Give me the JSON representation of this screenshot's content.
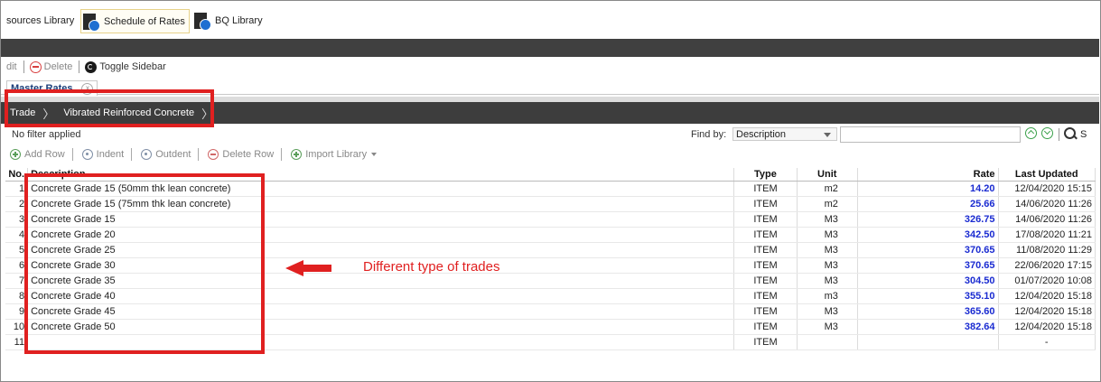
{
  "tabs": [
    {
      "label": "sources Library",
      "icon": "library-icon"
    },
    {
      "label": "Schedule of Rates",
      "icon": "rates-book-icon",
      "active": true
    },
    {
      "label": "BQ Library",
      "icon": "bq-book-icon"
    }
  ],
  "toolbar": {
    "edit_label": "dit",
    "delete_label": "Delete",
    "toggle_sidebar_label": "Toggle Sidebar"
  },
  "subtab": {
    "label": "Master Rates",
    "close": "x"
  },
  "breadcrumb": {
    "items": [
      "Trade",
      "Vibrated Reinforced Concrete"
    ]
  },
  "filter": {
    "status": "No filter applied",
    "find_by_label": "Find by:",
    "find_by_value": "Description",
    "search_label": "S",
    "search_value": ""
  },
  "row_tools": {
    "add_row": "Add Row",
    "indent": "Indent",
    "outdent": "Outdent",
    "delete_row": "Delete Row",
    "import_library": "Import Library"
  },
  "table": {
    "headers": {
      "no": "No.",
      "description": "Description",
      "type": "Type",
      "unit": "Unit",
      "rate": "Rate",
      "last_updated": "Last Updated"
    },
    "rows": [
      {
        "no": "1",
        "description": "Concrete Grade 15 (50mm thk lean concrete)",
        "type": "ITEM",
        "unit": "m2",
        "rate": "14.20",
        "last_updated": "12/04/2020 15:15"
      },
      {
        "no": "2",
        "description": "Concrete Grade 15 (75mm thk lean concrete)",
        "type": "ITEM",
        "unit": "m2",
        "rate": "25.66",
        "last_updated": "14/06/2020 11:26"
      },
      {
        "no": "3",
        "description": "Concrete Grade 15",
        "type": "ITEM",
        "unit": "M3",
        "rate": "326.75",
        "last_updated": "14/06/2020 11:26"
      },
      {
        "no": "4",
        "description": "Concrete Grade 20",
        "type": "ITEM",
        "unit": "M3",
        "rate": "342.50",
        "last_updated": "17/08/2020 11:21"
      },
      {
        "no": "5",
        "description": "Concrete Grade 25",
        "type": "ITEM",
        "unit": "M3",
        "rate": "370.65",
        "last_updated": "11/08/2020 11:29"
      },
      {
        "no": "6",
        "description": "Concrete Grade 30",
        "type": "ITEM",
        "unit": "M3",
        "rate": "370.65",
        "last_updated": "22/06/2020 17:15"
      },
      {
        "no": "7",
        "description": "Concrete Grade 35",
        "type": "ITEM",
        "unit": "M3",
        "rate": "304.50",
        "last_updated": "01/07/2020 10:08"
      },
      {
        "no": "8",
        "description": "Concrete Grade 40",
        "type": "ITEM",
        "unit": "m3",
        "rate": "355.10",
        "last_updated": "12/04/2020 15:18"
      },
      {
        "no": "9",
        "description": "Concrete Grade 45",
        "type": "ITEM",
        "unit": "M3",
        "rate": "365.60",
        "last_updated": "12/04/2020 15:18"
      },
      {
        "no": "10",
        "description": "Concrete Grade 50",
        "type": "ITEM",
        "unit": "M3",
        "rate": "382.64",
        "last_updated": "12/04/2020 15:18"
      },
      {
        "no": "11",
        "description": "",
        "type": "ITEM",
        "unit": "",
        "rate": "",
        "last_updated": "-"
      }
    ]
  },
  "annotation": {
    "text": "Different type of trades",
    "color": "#e02020"
  },
  "colors": {
    "rate_value": "#1a2bd1",
    "header_bar": "#404040",
    "breadcrumb_bar": "#3d3d3d",
    "subtab_text": "#1c3f7a"
  }
}
